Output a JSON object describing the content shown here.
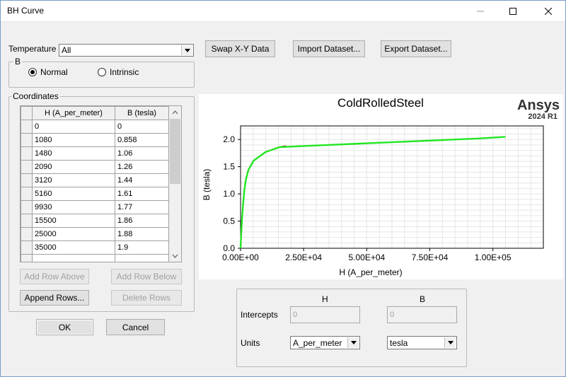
{
  "window": {
    "title": "BH Curve"
  },
  "temperature": {
    "label": "Temperature",
    "value": "All"
  },
  "buttons": {
    "swap": "Swap X-Y Data",
    "import": "Import Dataset...",
    "export": "Export Dataset...",
    "add_above": "Add Row Above",
    "add_below": "Add Row Below",
    "append": "Append Rows...",
    "delete": "Delete Rows",
    "ok": "OK",
    "cancel": "Cancel"
  },
  "b_group": {
    "label": "B",
    "normal": "Normal",
    "intrinsic": "Intrinsic",
    "selected": "Normal"
  },
  "coordinates": {
    "label": "Coordinates",
    "headers": [
      "H (A_per_meter)",
      "B (tesla)"
    ],
    "rows": [
      [
        "0",
        "0"
      ],
      [
        "1080",
        "0.858"
      ],
      [
        "1480",
        "1.06"
      ],
      [
        "2090",
        "1.26"
      ],
      [
        "3120",
        "1.44"
      ],
      [
        "5160",
        "1.61"
      ],
      [
        "9930",
        "1.77"
      ],
      [
        "15500",
        "1.86"
      ],
      [
        "25000",
        "1.88"
      ],
      [
        "35000",
        "1.9"
      ]
    ]
  },
  "brand": {
    "name": "Ansys",
    "version": "2024 R1"
  },
  "chart_data": {
    "type": "line",
    "title": "ColdRolledSteel",
    "xlabel": "H (A_per_meter)",
    "ylabel": "B (tesla)",
    "xlim": [
      0,
      120000
    ],
    "ylim": [
      0,
      2.25
    ],
    "xticks": [
      "0.00E+00",
      "2.50E+04",
      "5.00E+04",
      "7.50E+04",
      "1.00E+05"
    ],
    "xtick_values": [
      0,
      25000,
      50000,
      75000,
      100000
    ],
    "yticks": [
      "0.0",
      "0.5",
      "1.0",
      "1.5",
      "2.0"
    ],
    "ytick_values": [
      0,
      0.5,
      1.0,
      1.5,
      2.0
    ],
    "grid": true,
    "series": [
      {
        "color": "#c0392b",
        "x": [
          0,
          300,
          600,
          1080,
          1480,
          2090,
          3120,
          5160,
          9930,
          15500,
          18000
        ],
        "y": [
          0,
          0.3,
          0.55,
          0.858,
          1.06,
          1.26,
          1.44,
          1.61,
          1.77,
          1.86,
          1.88
        ]
      },
      {
        "color": "#22e622",
        "x": [
          0,
          300,
          600,
          1080,
          1480,
          2090,
          3120,
          5160,
          9930,
          15500,
          25000,
          35000,
          50000,
          65000,
          80000,
          95000,
          105000
        ],
        "y": [
          0,
          0.3,
          0.55,
          0.858,
          1.06,
          1.26,
          1.44,
          1.61,
          1.77,
          1.86,
          1.88,
          1.9,
          1.93,
          1.96,
          1.99,
          2.02,
          2.05
        ]
      }
    ]
  },
  "bottom": {
    "h_header": "H",
    "b_header": "B",
    "intercepts_label": "Intercepts",
    "units_label": "Units",
    "h_intercept": "0",
    "b_intercept": "0",
    "h_units": "A_per_meter",
    "b_units": "tesla"
  }
}
